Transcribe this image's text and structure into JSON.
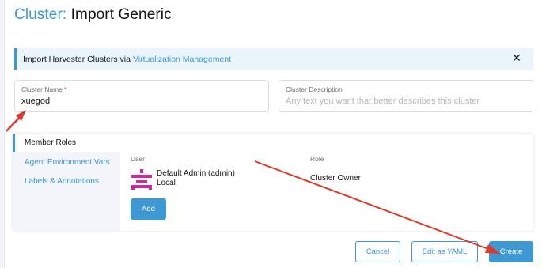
{
  "header": {
    "crumb": "Cluster:",
    "title": "Import Generic"
  },
  "banner": {
    "text": "Import Harvester Clusters via",
    "link": "Virtualization Management",
    "close_icon": "close-icon"
  },
  "form": {
    "cluster_name": {
      "label": "Cluster Name",
      "required_mark": "*",
      "value": "xuegod"
    },
    "cluster_description": {
      "label": "Cluster Description",
      "placeholder": "Any text you want that better describes this cluster",
      "value": ""
    }
  },
  "tabs": [
    {
      "label": "Member Roles",
      "active": true
    },
    {
      "label": "Agent Environment Vars",
      "active": false
    },
    {
      "label": "Labels & Annotations",
      "active": false
    }
  ],
  "members": {
    "headers": {
      "user": "User",
      "role": "Role"
    },
    "rows": [
      {
        "name": "Default Admin (admin)",
        "provider": "Local",
        "role": "Cluster Owner",
        "avatar_color": "#d0289e"
      }
    ],
    "add_label": "Add"
  },
  "footer": {
    "cancel": "Cancel",
    "edit_yaml": "Edit as YAML",
    "create": "Create"
  },
  "colors": {
    "accent": "#3d98d3",
    "annotation_arrow": "#e0392b",
    "avatar": "#d0289e"
  }
}
